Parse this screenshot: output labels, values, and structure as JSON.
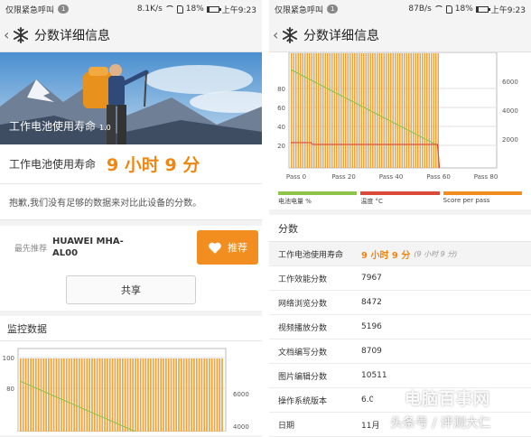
{
  "colors": {
    "accent": "#f0860f",
    "button": "#f28d1f",
    "bars": "#f2a23a",
    "green_line": "#8fc44a",
    "red_line": "#d94a3a"
  },
  "left": {
    "status": {
      "carrier": "仅限紧急呼叫",
      "badge": "1",
      "speed": "8.1K/s",
      "battery": "18%",
      "time": "上午9:23"
    },
    "appbar": {
      "back_icon": "chevron-left-icon",
      "logo_icon": "snowflake-icon",
      "title": "分数详细信息"
    },
    "hero": {
      "caption": "工作电池使用寿命",
      "version": "1.0"
    },
    "score": {
      "label": "工作电池使用寿命",
      "value": "9 小时 9 分"
    },
    "note": "抱歉,我们没有足够的数据来对比此设备的分数。",
    "recommend": {
      "label": "最先推荐",
      "device": "HUAWEI MHA-AL00",
      "button": "推荐",
      "button_icon": "heart-icon"
    },
    "share": "共享",
    "monitor_title": "监控数据",
    "mini_chart": {
      "y_left": [
        "100",
        "80"
      ],
      "y_right": [
        "6000",
        "4000"
      ]
    }
  },
  "right": {
    "status": {
      "carrier": "仅限紧急呼叫",
      "badge": "1",
      "speed": "87B/s",
      "battery": "18%",
      "time": "上午9:23"
    },
    "appbar": {
      "back_icon": "chevron-left-icon",
      "logo_icon": "snowflake-icon",
      "title": "分数详细信息"
    },
    "legend": [
      {
        "label": "电池电量 %",
        "color": "#8fc44a"
      },
      {
        "label": "温度 °C",
        "color": "#d94a3a"
      },
      {
        "label": "Score per pass",
        "color": "#f28d1f"
      }
    ],
    "section_title": "分数",
    "rows": [
      {
        "key": "工作电池使用寿命",
        "value": "9 小时 9 分",
        "sub": "(9 小时 9 分)"
      },
      {
        "key": "工作效能分数",
        "value": "7967"
      },
      {
        "key": "网络浏览分数",
        "value": "8472"
      },
      {
        "key": "视频播放分数",
        "value": "5196"
      },
      {
        "key": "文档编写分数",
        "value": "8709"
      },
      {
        "key": "图片编辑分数",
        "value": "10511"
      },
      {
        "key": "操作系统版本",
        "value": "6.0"
      },
      {
        "key": "日期",
        "value": "11月"
      }
    ]
  },
  "chart_data": {
    "type": "bar",
    "x_ticks": [
      "Pass 0",
      "Pass 20",
      "Pass 40",
      "Pass 60",
      "Pass 80"
    ],
    "y_left_ticks": [
      "20",
      "40",
      "60",
      "80"
    ],
    "y_right_ticks": [
      "2000",
      "4000",
      "6000"
    ],
    "passes": 89,
    "score_per_pass_level": 8000,
    "battery_percent": {
      "start": 100,
      "end_pass": 65,
      "end": 20
    },
    "temperature_c": {
      "value": 21,
      "end_pass": 65
    }
  },
  "watermark": {
    "brand": "电脑百事网",
    "tag": "头条号 / 评测大仁"
  }
}
